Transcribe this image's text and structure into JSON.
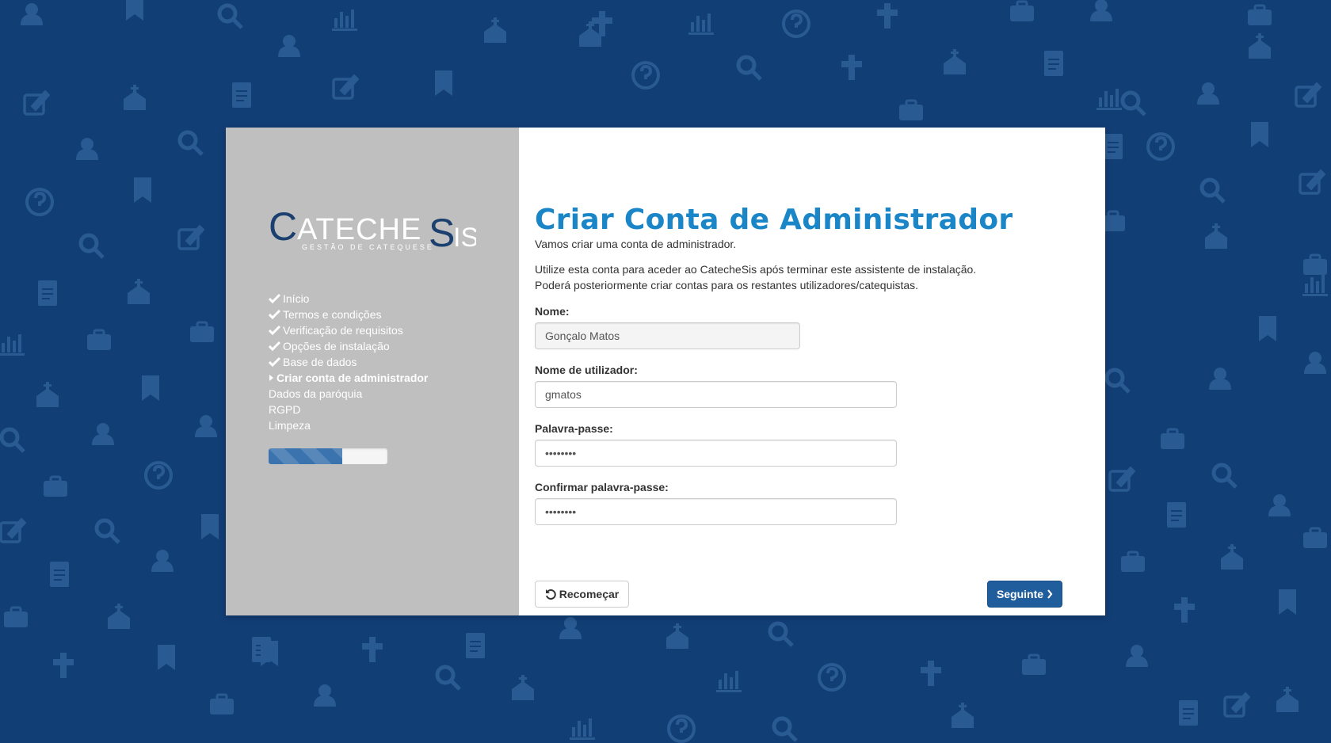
{
  "app": {
    "logo_text": "CATECHESIS",
    "logo_tagline": "GESTÃO DE CATEQUESE"
  },
  "sidebar": {
    "steps": [
      {
        "label": "Início",
        "state": "done"
      },
      {
        "label": "Termos e condições",
        "state": "done"
      },
      {
        "label": "Verificação de requisitos",
        "state": "done"
      },
      {
        "label": "Opções de instalação",
        "state": "done"
      },
      {
        "label": "Base de dados",
        "state": "done"
      },
      {
        "label": "Criar conta de administrador",
        "state": "active"
      },
      {
        "label": "Dados da paróquia",
        "state": "pending"
      },
      {
        "label": "RGPD",
        "state": "pending"
      },
      {
        "label": "Limpeza",
        "state": "pending"
      }
    ],
    "progress_percent": 62
  },
  "main": {
    "title": "Criar Conta de Administrador",
    "intro": "Vamos criar uma conta de administrador.",
    "desc_line1": "Utilize esta conta para aceder ao CatecheSis após terminar este assistente de instalação.",
    "desc_line2": "Poderá posteriormente criar contas para os restantes utilizadores/catequistas.",
    "fields": {
      "name_label": "Nome:",
      "name_value": "Gonçalo Matos",
      "username_label": "Nome de utilizador:",
      "username_value": "gmatos",
      "password_label": "Palavra-passe:",
      "password_value": "••••••••",
      "confirm_label": "Confirmar palavra-passe:",
      "confirm_value": "••••••••"
    },
    "buttons": {
      "restart_label": "Recomeçar",
      "next_label": "Seguinte"
    }
  },
  "colors": {
    "background": "#123e76",
    "sidebar": "#bfbfbf",
    "title": "#1a86c8",
    "primary_button": "#1f5d9c",
    "logo": "#1b3f6e"
  },
  "icons": {
    "step_done": "check-icon",
    "step_active": "caret-right-icon",
    "restart": "undo-icon",
    "next": "chevron-right-icon"
  }
}
